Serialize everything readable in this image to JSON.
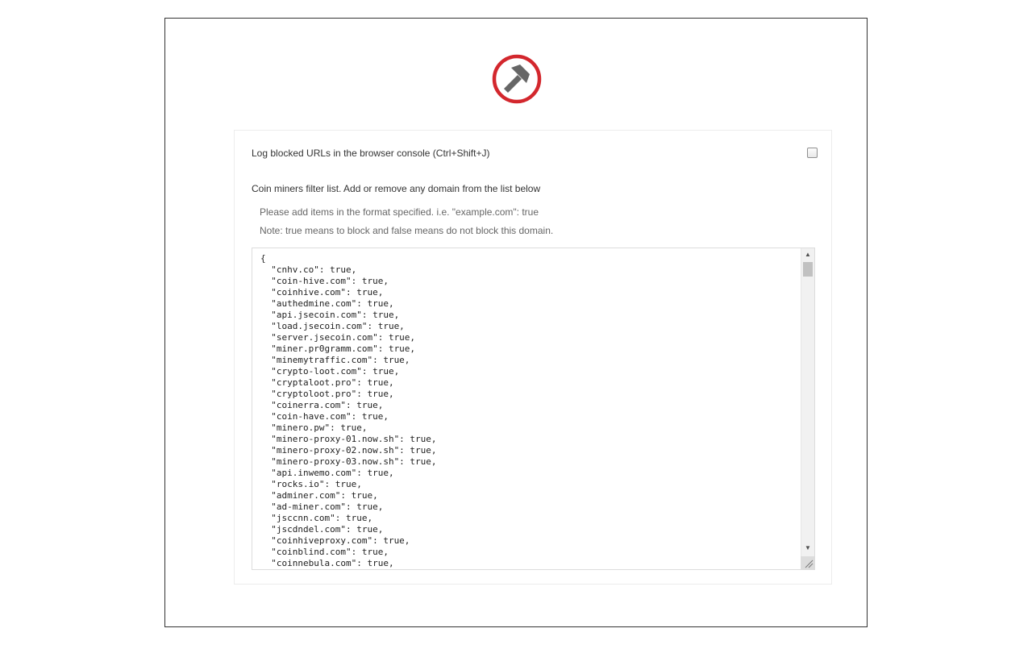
{
  "logo": {
    "icon": "pickaxe-blocked-icon",
    "ring_color": "#d3272d",
    "pick_color": "#666666"
  },
  "options": {
    "log_label": "Log blocked URLs in the browser console (Ctrl+Shift+J)",
    "log_checked": false
  },
  "filter": {
    "title": "Coin miners filter list. Add or remove any domain from the list below",
    "hint_format": "Please add items in the format specified. i.e. \"example.com\": true",
    "hint_note": "Note: true means to block and false means do not block this domain.",
    "list_text": "{\n  \"cnhv.co\": true,\n  \"coin-hive.com\": true,\n  \"coinhive.com\": true,\n  \"authedmine.com\": true,\n  \"api.jsecoin.com\": true,\n  \"load.jsecoin.com\": true,\n  \"server.jsecoin.com\": true,\n  \"miner.pr0gramm.com\": true,\n  \"minemytraffic.com\": true,\n  \"crypto-loot.com\": true,\n  \"cryptaloot.pro\": true,\n  \"cryptoloot.pro\": true,\n  \"coinerra.com\": true,\n  \"coin-have.com\": true,\n  \"minero.pw\": true,\n  \"minero-proxy-01.now.sh\": true,\n  \"minero-proxy-02.now.sh\": true,\n  \"minero-proxy-03.now.sh\": true,\n  \"api.inwemo.com\": true,\n  \"rocks.io\": true,\n  \"adminer.com\": true,\n  \"ad-miner.com\": true,\n  \"jsccnn.com\": true,\n  \"jscdndel.com\": true,\n  \"coinhiveproxy.com\": true,\n  \"coinblind.com\": true,\n  \"coinnebula.com\": true,"
  },
  "scrollbar": {
    "up_icon": "arrow-up-icon",
    "down_icon": "arrow-down-icon",
    "up_glyph": "▲",
    "down_glyph": "▼"
  }
}
